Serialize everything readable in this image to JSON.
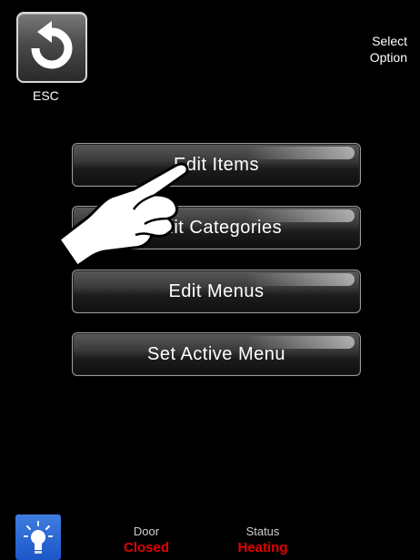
{
  "header": {
    "esc_label": "ESC",
    "title_line1": "Select",
    "title_line2": "Option"
  },
  "menu": {
    "items": [
      {
        "label": "Edit Items"
      },
      {
        "label": "Edit Categories"
      },
      {
        "label": "Edit Menus"
      },
      {
        "label": "Set Active Menu"
      }
    ]
  },
  "footer": {
    "light_icon": "light-bulb-icon",
    "door": {
      "label": "Door",
      "value": "Closed"
    },
    "status": {
      "label": "Status",
      "value": "Heating"
    }
  },
  "colors": {
    "background": "#000000",
    "status_value": "#e60000",
    "light_button": "#1b57c7"
  }
}
